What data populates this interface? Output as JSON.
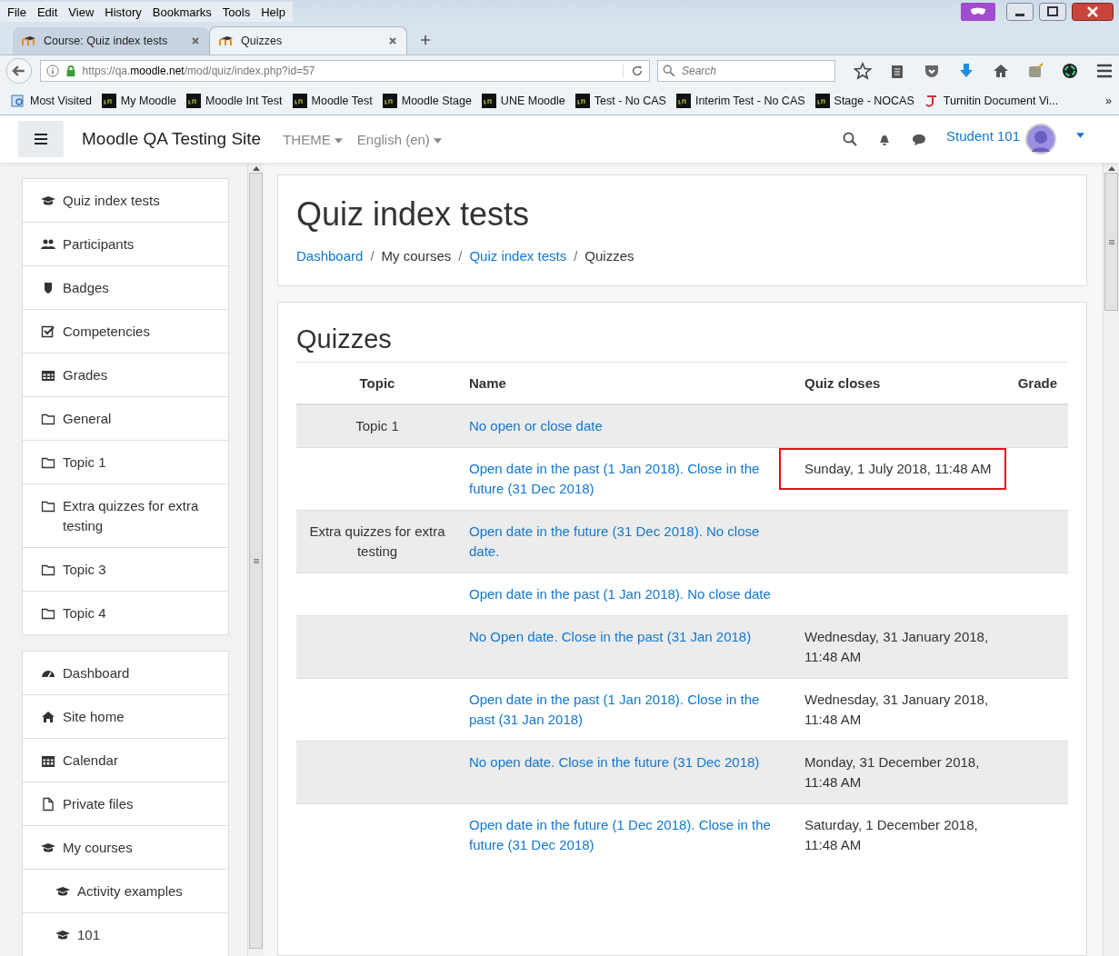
{
  "browser": {
    "menu": [
      "File",
      "Edit",
      "View",
      "History",
      "Bookmarks",
      "Tools",
      "Help"
    ],
    "tabs": [
      {
        "label": "Course: Quiz index tests",
        "selected": false
      },
      {
        "label": "Quizzes",
        "selected": true
      }
    ],
    "url": {
      "host_prefix": "https://qa.",
      "domain": "moodle.net",
      "path": "/mod/quiz/index.php?id=57"
    },
    "search": {
      "placeholder": "Search"
    },
    "bookmarks": [
      {
        "label": "Most Visited",
        "kind": "folder"
      },
      {
        "label": "My Moodle",
        "kind": "une"
      },
      {
        "label": "Moodle Int Test",
        "kind": "une"
      },
      {
        "label": "Moodle Test",
        "kind": "une"
      },
      {
        "label": "Moodle Stage",
        "kind": "une"
      },
      {
        "label": "UNE Moodle",
        "kind": "une"
      },
      {
        "label": "Test - No CAS",
        "kind": "une"
      },
      {
        "label": "Interim Test - No CAS",
        "kind": "une"
      },
      {
        "label": "Stage - NOCAS",
        "kind": "une"
      },
      {
        "label": "Turnitin Document Vi...",
        "kind": "turnitin"
      }
    ],
    "bookmarks_more": "»"
  },
  "site": {
    "name": "Moodle QA Testing Site",
    "menus": [
      "THEME",
      "English (en)"
    ],
    "user": "Student 101"
  },
  "sidebar": {
    "groups": [
      [
        {
          "label": "Quiz index tests"
        },
        {
          "label": "Participants"
        },
        {
          "label": "Badges"
        },
        {
          "label": "Competencies"
        },
        {
          "label": "Grades"
        },
        {
          "label": "General"
        },
        {
          "label": "Topic 1"
        },
        {
          "label": "Extra quizzes for extra testing"
        },
        {
          "label": "Topic 3"
        },
        {
          "label": "Topic 4"
        }
      ],
      [
        {
          "label": "Dashboard"
        },
        {
          "label": "Site home"
        },
        {
          "label": "Calendar"
        },
        {
          "label": "Private files"
        },
        {
          "label": "My courses",
          "children": [
            {
              "label": "Activity examples"
            },
            {
              "label": "101"
            }
          ]
        }
      ]
    ]
  },
  "header": {
    "title": "Quiz index tests",
    "separator": "/",
    "breadcrumb": [
      {
        "label": "Dashboard",
        "link": true
      },
      {
        "label": "My courses",
        "link": false
      },
      {
        "label": "Quiz index tests",
        "link": true
      },
      {
        "label": "Quizzes",
        "link": false
      }
    ]
  },
  "quizzes": {
    "heading": "Quizzes",
    "columns": [
      "Topic",
      "Name",
      "Quiz closes",
      "Grade"
    ],
    "rows": [
      {
        "topic": "Topic 1",
        "name": "No open or close date",
        "closes": "",
        "highlighted": false
      },
      {
        "topic": "",
        "name": "Open date in the past (1 Jan 2018). Close in the future (31 Dec 2018)",
        "closes": "Sunday, 1 July 2018, 11:48 AM",
        "highlighted": true
      },
      {
        "topic": "Extra quizzes for extra testing",
        "name": "Open date in the future (31 Dec 2018). No close date.",
        "closes": "",
        "highlighted": false
      },
      {
        "topic": "",
        "name": "Open date in the past (1 Jan 2018). No close date",
        "closes": "",
        "highlighted": false
      },
      {
        "topic": "",
        "name": "No Open date. Close in the past (31 Jan 2018)",
        "closes": "Wednesday, 31 January 2018, 11:48 AM",
        "highlighted": false
      },
      {
        "topic": "",
        "name": "Open date in the past (1 Jan 2018). Close in the past (31 Jan 2018)",
        "closes": "Wednesday, 31 January 2018, 11:48 AM",
        "highlighted": false
      },
      {
        "topic": "",
        "name": "No open date. Close in the future (31 Dec 2018)",
        "closes": "Monday, 31 December 2018, 11:48 AM",
        "highlighted": false
      },
      {
        "topic": "",
        "name": "Open date in the future (1 Dec 2018). Close in the future (31 Dec 2018)",
        "closes": "Saturday, 1 December 2018, 11:48 AM",
        "highlighted": false
      }
    ]
  }
}
